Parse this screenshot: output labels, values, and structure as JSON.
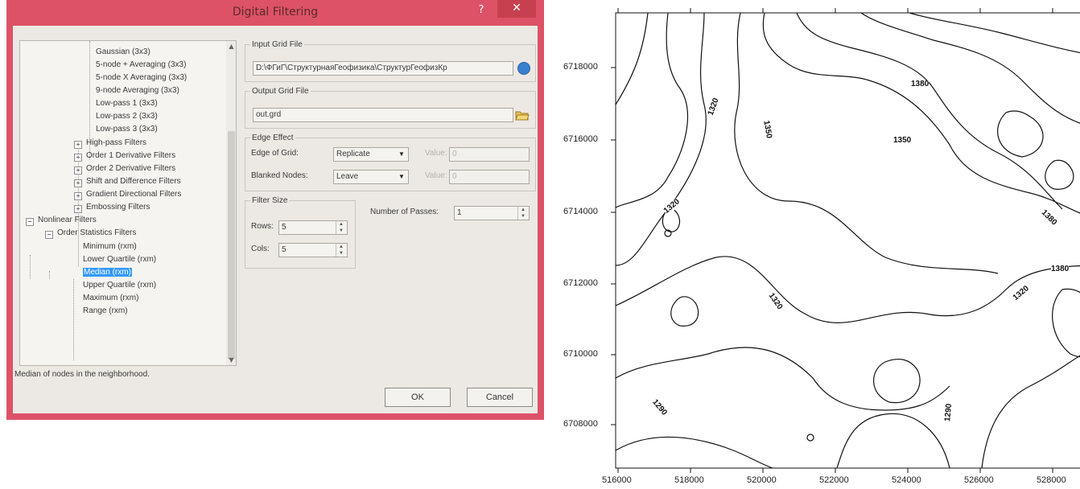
{
  "dialog": {
    "title": "Digital Filtering",
    "help": "?",
    "close": "✕",
    "tree": {
      "items": [
        "Gaussian (3x3)",
        "5-node + Averaging (3x3)",
        "5-node X Averaging (3x3)",
        "9-node Averaging (3x3)",
        "Low-pass 1 (3x3)",
        "Low-pass 2 (3x3)",
        "Low-pass 3 (3x3)",
        "High-pass Filters",
        "Order 1 Derivative Filters",
        "Order 2 Derivative Filters",
        "Shift and Difference Filters",
        "Gradient Directional Filters",
        "Embossing Filters",
        "Nonlinear Filters",
        "Order Statistics Filters",
        "Minimum (rxm)",
        "Lower Quartile (rxm)",
        "Median (rxm)",
        "Upper Quartile (rxm)",
        "Maximum (rxm)",
        "Range (rxm)"
      ],
      "selected": "Median (rxm)"
    },
    "status": "Median of nodes in the neighborhood.",
    "input_grid": {
      "legend": "Input Grid File",
      "value": "D:\\ФГиГ\\СтруктурнаяГеофизика\\СтруктурГеофизКр"
    },
    "output_grid": {
      "legend": "Output Grid File",
      "value": "out.grd"
    },
    "edge_effect": {
      "legend": "Edge Effect",
      "edge_of_grid_label": "Edge of Grid:",
      "edge_of_grid_value": "Replicate",
      "value_label": "Value:",
      "value_value": "0",
      "blanked_label": "Blanked Nodes:",
      "blanked_value": "Leave",
      "blanked_value_label": "Value:",
      "blanked_value_value": "0"
    },
    "filter_size": {
      "legend": "Filter Size",
      "rows_label": "Rows:",
      "rows_value": "5",
      "cols_label": "Cols:",
      "cols_value": "5"
    },
    "passes": {
      "label": "Number of Passes:",
      "value": "1"
    },
    "ok": "OK",
    "cancel": "Cancel"
  },
  "map": {
    "y_ticks": [
      "6718000",
      "6716000",
      "6714000",
      "6712000",
      "6710000",
      "6708000"
    ],
    "x_ticks": [
      "516000",
      "518000",
      "520000",
      "522000",
      "524000",
      "526000",
      "528000"
    ],
    "contour_labels": [
      "1320",
      "1350",
      "1380",
      "1350",
      "1380",
      "1320",
      "1380",
      "1320",
      "1320",
      "1290",
      "1290"
    ]
  }
}
